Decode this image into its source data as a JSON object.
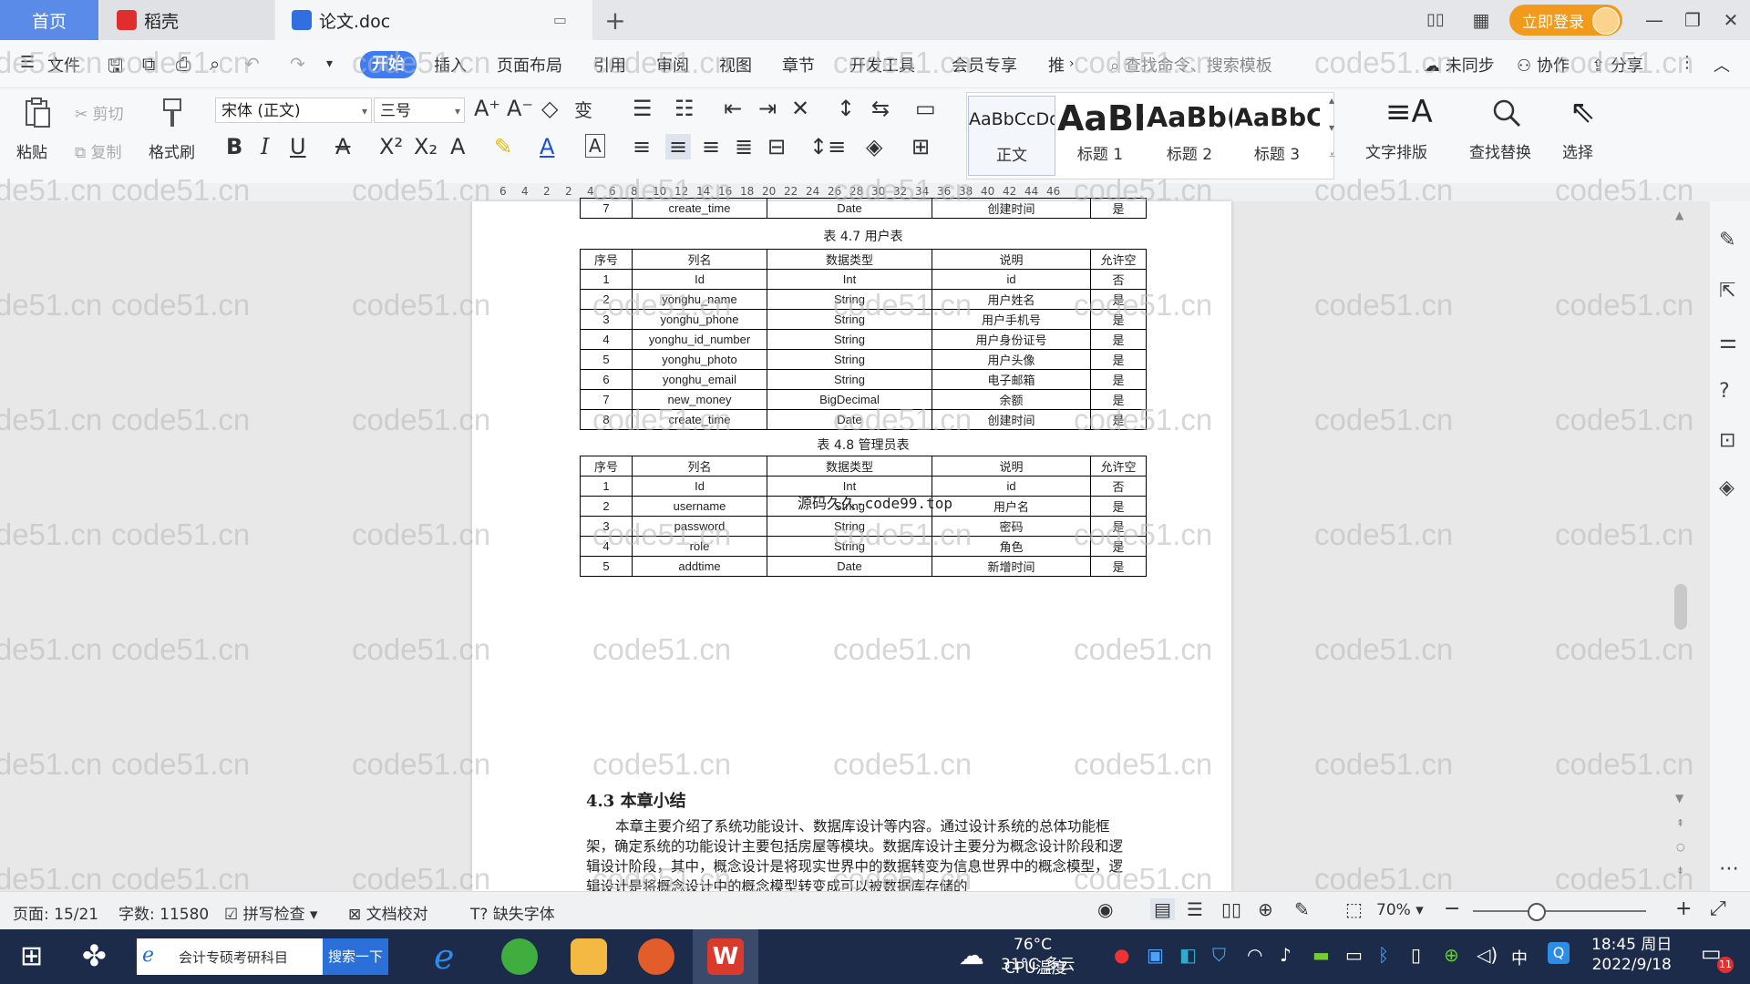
{
  "tabs": {
    "home": "首页",
    "daoke": "稻壳",
    "doc": "论文.doc"
  },
  "header": {
    "login": "立即登录"
  },
  "menu": {
    "file": "文件",
    "items": [
      "开始",
      "插入",
      "页面布局",
      "引用",
      "审阅",
      "视图",
      "章节",
      "开发工具",
      "会员专享",
      "推"
    ],
    "search_cmd": "查找命令、搜索模板",
    "sync": "未同步",
    "collab": "协作",
    "share": "分享"
  },
  "ribbon": {
    "paste": "粘贴",
    "cut": "剪切",
    "copy": "复制",
    "format_painter": "格式刷",
    "font": "宋体 (正文)",
    "size": "三号",
    "styles": [
      {
        "preview": "AaBbCcDd",
        "name": "正文"
      },
      {
        "preview": "AaBb",
        "name": "标题 1"
      },
      {
        "preview": "AaBb(",
        "name": "标题 2"
      },
      {
        "preview": "AaBbC",
        "name": "标题 3"
      }
    ],
    "text_layout": "文字排版",
    "find_replace": "查找替换",
    "select": "选择"
  },
  "ruler": {
    "ticks": [
      "6",
      "4",
      "2",
      "2",
      "4",
      "6",
      "8",
      "10",
      "12",
      "14",
      "16",
      "18",
      "20",
      "22",
      "24",
      "26",
      "28",
      "30",
      "32",
      "34",
      "36",
      "38",
      "40",
      "42",
      "44",
      "46"
    ]
  },
  "document": {
    "top_row": [
      "7",
      "create_time",
      "Date",
      "创建时间",
      "是"
    ],
    "table1_caption": "表 4.7 用户表",
    "table1_header": [
      "序号",
      "列名",
      "数据类型",
      "说明",
      "允许空"
    ],
    "table1_rows": [
      [
        "1",
        "Id",
        "Int",
        "id",
        "否"
      ],
      [
        "2",
        "yonghu_name",
        "String",
        "用户姓名",
        "是"
      ],
      [
        "3",
        "yonghu_phone",
        "String",
        "用户手机号",
        "是"
      ],
      [
        "4",
        "yonghu_id_number",
        "String",
        "用户身份证号",
        "是"
      ],
      [
        "5",
        "yonghu_photo",
        "String",
        "用户头像",
        "是"
      ],
      [
        "6",
        "yonghu_email",
        "String",
        "电子邮箱",
        "是"
      ],
      [
        "7",
        "new_money",
        "BigDecimal",
        "余额",
        "是"
      ],
      [
        "8",
        "create_time",
        "Date",
        "创建时间",
        "是"
      ]
    ],
    "table2_caption": "表 4.8 管理员表",
    "table2_header": [
      "序号",
      "列名",
      "数据类型",
      "说明",
      "允许空"
    ],
    "table2_rows": [
      [
        "1",
        "Id",
        "Int",
        "id",
        "否"
      ],
      [
        "2",
        "username",
        "String",
        "用户名",
        "是"
      ],
      [
        "3",
        "password",
        "String",
        "密码",
        "是"
      ],
      [
        "4",
        "role",
        "String",
        "角色",
        "是"
      ],
      [
        "5",
        "addtime",
        "Date",
        "新增时间",
        "是"
      ]
    ],
    "overlay": "源码久久-code99.top",
    "section_title": "4.3 本章小结",
    "paragraph": "本章主要介绍了系统功能设计、数据库设计等内容。通过设计系统的总体功能框架，确定系统的功能设计主要包括房屋等模块。数据库设计主要分为概念设计阶段和逻辑设计阶段，其中，概念设计是将现实世界中的数据转变为信息世界中的概念模型，逻辑设计是将概念设计中的概念模型转变成可以被数据库存储的"
  },
  "watermark": "code51.cn",
  "status": {
    "page": "页面: 15/21",
    "words": "字数: 11580",
    "spell": "拼写检查",
    "proof": "文档校对",
    "missing_font": "缺失字体",
    "zoom": "70%"
  },
  "taskbar": {
    "search_text": "会计专硕考研科目",
    "search_btn": "搜索一下",
    "weather_temp": "31°C 多云",
    "cpu": "76°C",
    "cpu_label": "CPU温度",
    "ime": "中",
    "time": "18:45 周日",
    "date": "2022/9/18",
    "notif": "11"
  },
  "colors": {
    "accent": "#3d7cf5",
    "home_tab": "#5b8be8",
    "login": "#f29a1c",
    "taskbar": "#1d2b4a",
    "wps_red": "#d93a2b"
  }
}
